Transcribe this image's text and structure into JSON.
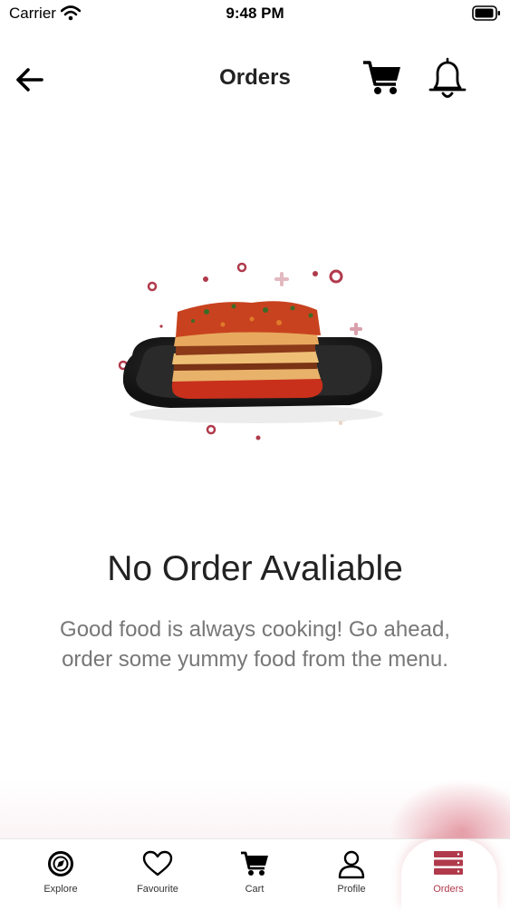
{
  "status_bar": {
    "carrier": "Carrier",
    "time": "9:48 PM"
  },
  "header": {
    "title": "Orders",
    "back_icon": "arrow-left-icon",
    "cart_icon": "cart-icon",
    "bell_icon": "bell-icon"
  },
  "empty_state": {
    "title": "No Order Avaliable",
    "message": "Good food is always cooking! Go ahead, order some yummy food from the menu."
  },
  "bottom_nav": {
    "items": [
      {
        "label": "Explore",
        "icon": "compass-icon"
      },
      {
        "label": "Favourite",
        "icon": "heart-icon"
      },
      {
        "label": "Cart",
        "icon": "cart-icon"
      },
      {
        "label": "Profile",
        "icon": "user-icon"
      },
      {
        "label": "Orders",
        "icon": "orders-icon"
      }
    ],
    "active": "Orders",
    "accent_color": "#b03a4b"
  }
}
